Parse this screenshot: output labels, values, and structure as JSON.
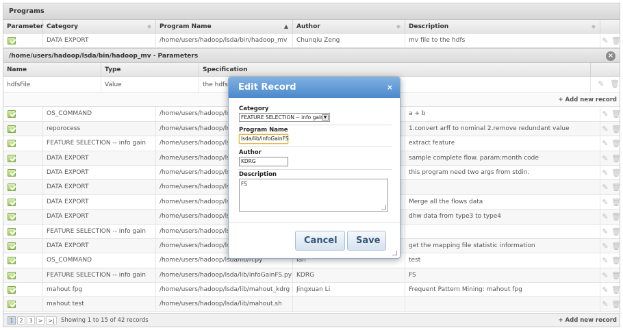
{
  "panel": {
    "title": "Programs"
  },
  "columns": [
    "Parameter",
    "Category",
    "Program Name",
    "Author",
    "Description"
  ],
  "first_row": {
    "category": "DATA EXPORT",
    "program": "/home/users/hadoop/lsda/bin/hadoop_mv",
    "author": "Chunqiu Zeng",
    "description": "mv file to the hdfs"
  },
  "params": {
    "title": "/home/users/hadoop/lsda/bin/hadoop_mv - Parameters",
    "columns": [
      "Name",
      "Type",
      "Specification"
    ],
    "row": {
      "name": "hdfsFile",
      "type": "Value",
      "spec": "the hdfs f"
    }
  },
  "add_new_record": "+ Add new record",
  "rows": [
    {
      "category": "OS_COMMAND",
      "program": "/home/users/hadoop/lsda",
      "author": "",
      "description": "a + b"
    },
    {
      "category": "reporocess",
      "program": "/home/users/hadoop/lsda",
      "author": "",
      "description": "1.convert arff to nominal 2.remove redundant value"
    },
    {
      "category": "FEATURE SELECTION -- info gain",
      "program": "/home/users/hadoop/lsda",
      "author": "",
      "description": "extract feature"
    },
    {
      "category": "DATA EXPORT",
      "program": "/home/users/hadoop/lsda",
      "author": "",
      "description": "sample complete flow. param:month code"
    },
    {
      "category": "DATA EXPORT",
      "program": "/home/users/hadoop/lsda",
      "author": "",
      "description": "this program need two args from stdin."
    },
    {
      "category": "DATA EXPORT",
      "program": "/home/users/hadoop/lsda",
      "author": "",
      "description": ""
    },
    {
      "category": "DATA EXPORT",
      "program": "/home/users/hadoop/lsda",
      "author": "",
      "description": "Merge all the flows data"
    },
    {
      "category": "DATA EXPORT",
      "program": "/home/users/hadoop/lsda",
      "author": "",
      "description": "dhw data from type3 to type4"
    },
    {
      "category": "FEATURE SELECTION -- info gain",
      "program": "/home/users/hadoop/lsda",
      "author": "",
      "description": ""
    },
    {
      "category": "DATA EXPORT",
      "program": "/home/users/hadoop/lsda",
      "author": "",
      "description": "get the mapping file statistic information"
    },
    {
      "category": "OS_COMMAND",
      "program": "/home/users/hadoop/lsda/lib/h.py",
      "author": "Ian",
      "description": "test"
    },
    {
      "category": "FEATURE SELECTION -- info gain",
      "program": "/home/users/hadoop/lsda/lib/infoGainFS.py",
      "author": "KDRG",
      "description": "FS"
    },
    {
      "category": "mahout fpg",
      "program": "/home/users/hadoop/lsda/lib/mahout_kdrg fpg",
      "author": "Jingxuan Li",
      "description": "Frequent Pattern Mining: mahout fpg"
    },
    {
      "category": "mahout test",
      "program": "/home/users/hadoop/lsda/lib/mahout.sh",
      "author": "",
      "description": ""
    }
  ],
  "pager": {
    "pages": [
      "1",
      "2",
      "3",
      ">",
      ">|"
    ],
    "info": "Showing 1 to 15 of 42 records"
  },
  "modal": {
    "title": "Edit Record",
    "close": "×",
    "category_label": "Category",
    "category_value": "FEATURE SELECTION -- info gain",
    "program_label": "Program Name",
    "program_value": "lsda/lib/infoGainFS",
    "author_label": "Author",
    "author_value": "KDRG",
    "description_label": "Description",
    "description_value": "FS",
    "cancel": "Cancel",
    "save": "Save"
  },
  "icons": {
    "edit": "edit-icon",
    "delete": "trash-icon",
    "param": "param-edit-icon",
    "close": "close-icon"
  }
}
